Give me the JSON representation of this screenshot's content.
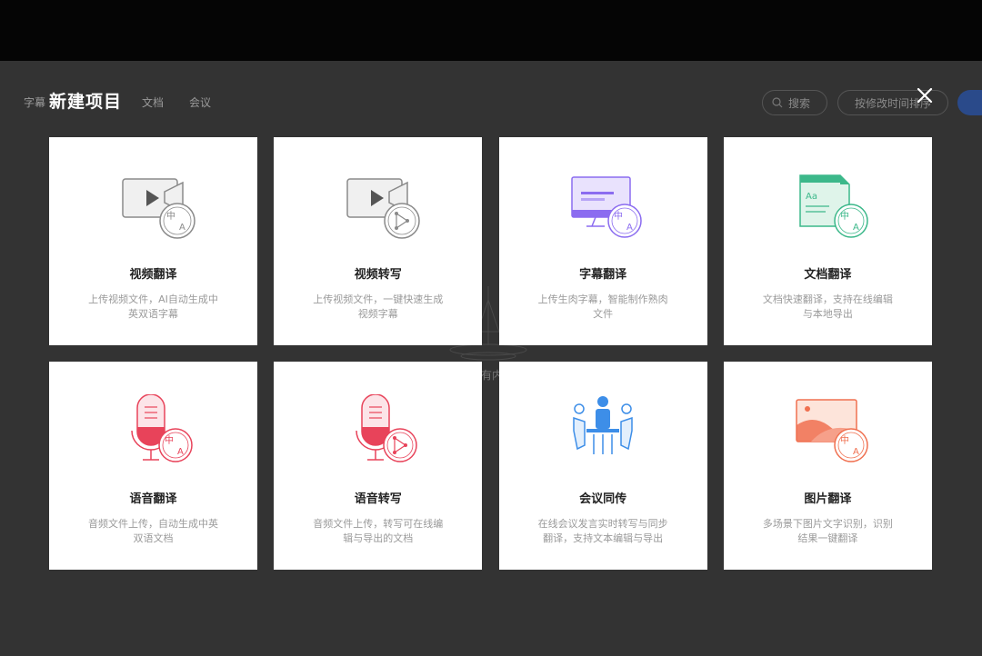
{
  "background": {
    "tabs": [
      "字幕",
      "文档",
      "会议"
    ],
    "search_label": "搜索",
    "sort_label": "按修改时间排序",
    "empty_text": "有内"
  },
  "dialog": {
    "title": "新建项目",
    "close_icon": "close-icon"
  },
  "cards": [
    {
      "title": "视频翻译",
      "desc": "上传视频文件，AI自动生成中英双语字幕",
      "icon": "video-translate-icon",
      "color": "#8a8a8a"
    },
    {
      "title": "视频转写",
      "desc": "上传视频文件，一键快速生成视频字幕",
      "icon": "video-transcribe-icon",
      "color": "#8a8a8a"
    },
    {
      "title": "字幕翻译",
      "desc": "上传生肉字幕，智能制作熟肉文件",
      "icon": "subtitle-translate-icon",
      "color": "#8b6cf0"
    },
    {
      "title": "文档翻译",
      "desc": "文档快速翻译，支持在线编辑与本地导出",
      "icon": "document-translate-icon",
      "color": "#3cb88a"
    },
    {
      "title": "语音翻译",
      "desc": "音频文件上传，自动生成中英双语文档",
      "icon": "audio-translate-icon",
      "color": "#e8435a"
    },
    {
      "title": "语音转写",
      "desc": "音频文件上传，转写可在线编辑与导出的文档",
      "icon": "audio-transcribe-icon",
      "color": "#e8435a"
    },
    {
      "title": "会议同传",
      "desc": "在线会议发言实时转写与同步翻译，支持文本编辑与导出",
      "icon": "meeting-interpret-icon",
      "color": "#3d8ee8"
    },
    {
      "title": "图片翻译",
      "desc": "多场景下图片文字识别，识别结果一键翻译",
      "icon": "image-translate-icon",
      "color": "#f07050"
    }
  ]
}
